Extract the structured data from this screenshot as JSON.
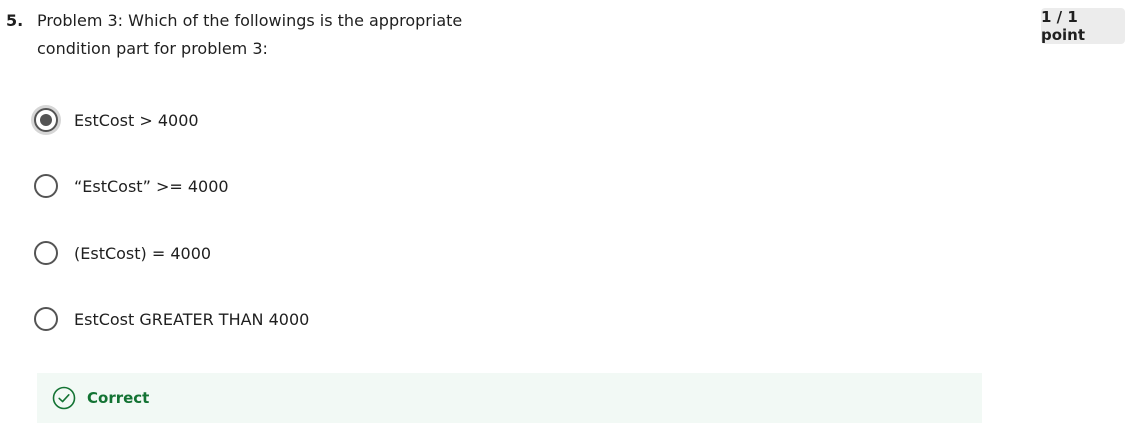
{
  "question": {
    "number": "5.",
    "text": "Problem 3: Which of the followings is the appropriate condition part for problem 3:",
    "points": "1 / 1 point"
  },
  "options": [
    {
      "label": "EstCost > 4000",
      "selected": true
    },
    {
      "label": "“EstCost” >= 4000",
      "selected": false
    },
    {
      "label": "(EstCost) = 4000",
      "selected": false
    },
    {
      "label": "EstCost GREATER THAN 4000",
      "selected": false
    }
  ],
  "feedback": {
    "icon": "check-circle-icon",
    "label": "Correct"
  },
  "colors": {
    "radio_border": "#545454",
    "feedback_background": "#f2f9f5",
    "feedback_text": "#137333",
    "points_background": "#ececec"
  }
}
